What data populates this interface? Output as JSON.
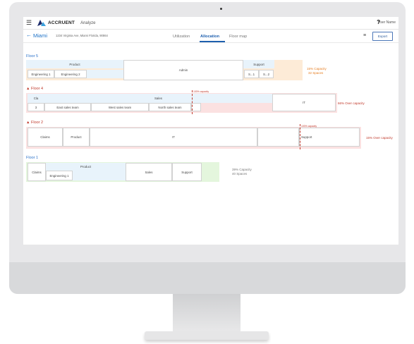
{
  "header": {
    "brand": "ACCRUENT",
    "app": "Analyze",
    "help": "?",
    "user": "User Name"
  },
  "location": {
    "name": "Miami",
    "address": "1234 Virginia Ave, Miami Florida, 90864"
  },
  "tabs": [
    {
      "label": "Utilization"
    },
    {
      "label": "Allocation"
    },
    {
      "label": "Floor map"
    }
  ],
  "toolbar": {
    "export": "Export"
  },
  "floors": {
    "f5": {
      "title": "Floor 5",
      "product": "Product",
      "eng1": "Engineering 1",
      "eng2": "Engineering 2",
      "admin": "Admin",
      "support": "Support",
      "s1": "S...1",
      "s2": "S...2",
      "cap1": "15% Capacity",
      "cap2": "32 Spaces"
    },
    "f4": {
      "title": "Floor 4",
      "cla": "Cla",
      "sales": "Sales",
      "n3": "3",
      "east": "East sales team",
      "west": "West sales team",
      "north": "North sales team",
      "it": "IT",
      "note": "100% capacity",
      "cap": "66% Over capacity"
    },
    "f2": {
      "title": "Floor 2",
      "claims": "Claims",
      "product": "Product",
      "it": "IT",
      "support": "Support",
      "note": "100% capacity",
      "cap": "15% Over capacity"
    },
    "f1": {
      "title": "Floor 1",
      "claims": "Claims",
      "product": "Product",
      "eng1": "Engineering 1",
      "sales": "Sales",
      "support": "Support",
      "cap1": "39% Capacity",
      "cap2": "40 Spaces"
    }
  },
  "colors": {
    "blue": "#e8f3fb",
    "orange": "#fdebd7",
    "red": "#fbe1e1",
    "green": "#e4f6dd",
    "link": "#1e72c7"
  }
}
